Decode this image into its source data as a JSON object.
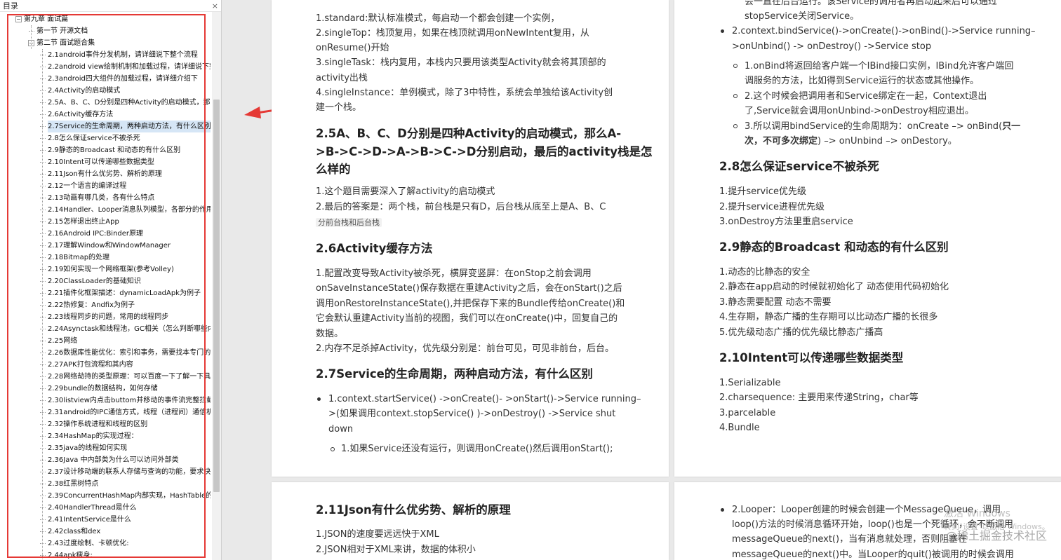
{
  "toc": {
    "title": "目录",
    "close": "×",
    "items": [
      {
        "label": "第九章 面试篇",
        "level": 0,
        "toggle": "−"
      },
      {
        "label": "第一节 开源文档",
        "level": 1
      },
      {
        "label": "第二节 面试题合集",
        "level": 1,
        "toggle": "−"
      },
      {
        "label": "2.1android事件分发机制，请详细说下整个流程",
        "level": 2
      },
      {
        "label": "2.2android view绘制机制和加载过程，请详细说下整",
        "level": 2
      },
      {
        "label": "2.3android四大组件的加载过程，请详细介绍下",
        "level": 2
      },
      {
        "label": "2.4Activity的启动模式",
        "level": 2
      },
      {
        "label": "2.5A、B、C、D分别是四种Activity的启动模式，那么A",
        "level": 2
      },
      {
        "label": "2.6Activity缓存方法",
        "level": 2
      },
      {
        "label": "2.7Service的生命周期，两种启动方法，有什么区别",
        "level": 2,
        "selected": true
      },
      {
        "label": "2.8怎么保证service不被杀死",
        "level": 2
      },
      {
        "label": "2.9静态的Broadcast 和动态的有什么区别",
        "level": 2
      },
      {
        "label": "2.10Intent可以传递哪些数据类型",
        "level": 2
      },
      {
        "label": "2.11Json有什么优劣势、解析的原理",
        "level": 2
      },
      {
        "label": "2.12一个语言的编译过程",
        "level": 2
      },
      {
        "label": "2.13动画有哪几类，各有什么特点",
        "level": 2
      },
      {
        "label": "2.14Handler、Looper消息队列模型，各部分的作用",
        "level": 2
      },
      {
        "label": "2.15怎样退出终止App",
        "level": 2
      },
      {
        "label": "2.16Android IPC:Binder原理",
        "level": 2
      },
      {
        "label": "2.17理解Window和WindowManager",
        "level": 2
      },
      {
        "label": "2.18Bitmap的处理",
        "level": 2
      },
      {
        "label": "2.19如何实现一个网络框架(参考Volley)",
        "level": 2
      },
      {
        "label": "2.20ClassLoader的基础知识",
        "level": 2
      },
      {
        "label": "2.21插件化框架描述：dynamicLoadApk为例子",
        "level": 2
      },
      {
        "label": "2.22热修复：Andfix为例子",
        "level": 2
      },
      {
        "label": "2.23线程同步的问题，常用的线程同步",
        "level": 2
      },
      {
        "label": "2.24Asynctask和线程池，GC相关（怎么判断哪些内",
        "level": 2
      },
      {
        "label": "2.25网络",
        "level": 2
      },
      {
        "label": "2.26数据库性能优化：索引和事务，需要找本专门的",
        "level": 2
      },
      {
        "label": "2.27APK打包流程和其内容",
        "level": 2
      },
      {
        "label": "2.28网络劫持的类型原理：可以百度一下了解一下具",
        "level": 2
      },
      {
        "label": "2.29bundle的数据结构，如何存储",
        "level": 2
      },
      {
        "label": "2.30listview内点击buttom并移动的事件流完整拦截",
        "level": 2
      },
      {
        "label": "2.31android的IPC通信方式，线程（进程间）通信机",
        "level": 2
      },
      {
        "label": "2.32操作系统进程和线程的区别",
        "level": 2
      },
      {
        "label": "2.34HashMap的实现过程：",
        "level": 2
      },
      {
        "label": "2.35java的线程如何实现",
        "level": 2
      },
      {
        "label": "2.36Java 中内部类为什么可以访问外部类",
        "level": 2
      },
      {
        "label": "2.37设计移动端的联系人存储与查询的功能，要求快",
        "level": 2
      },
      {
        "label": "2.38红黑树特点",
        "level": 2
      },
      {
        "label": "2.39ConcurrentHashMap内部实现，HashTable的",
        "level": 2
      },
      {
        "label": "2.40HandlerThread是什么",
        "level": 2
      },
      {
        "label": "2.41IntentService是什么",
        "level": 2
      },
      {
        "label": "2.42class和dex",
        "level": 2
      },
      {
        "label": "2.43过度绘制、卡顿优化:",
        "level": 2
      },
      {
        "label": "2.44apk瘦身:",
        "level": 2
      }
    ]
  },
  "page1": {
    "lines": [
      "1.standard:默认标准模式，每启动一个都会创建一个实例，",
      "2.singleTop：栈顶复用，如果在栈顶就调用onNewIntent复用，从",
      "onResume()开始",
      "3.singleTask：栈内复用，本栈内只要用该类型Activity就会将其顶部的",
      "activity出栈",
      "4.singleInstance：单例模式，除了3中特性，系统会单独给该Activity创",
      "建一个栈。"
    ],
    "h25": [
      "2.5A、B、C、D分别是四种Activity的启动模式，那么A-",
      ">B->C->D->A->B->C->D分别启动，最后的activity栈是怎",
      "么样的"
    ],
    "s25": [
      "1.这个题目需要深入了解activity的启动模式",
      "2.最后的答案是：两个栈，前台栈是只有D，后台栈从底至上是A、B、C"
    ],
    "s25_code": "分前台栈和后台栈",
    "h26": "2.6Activity缓存方法",
    "s26": [
      "1.配置改变导致Activity被杀死，横屏变竖屏：在onStop之前会调用",
      "onSaveInstanceState()保存数据在重建Activity之后，会在onStart()之后",
      "调用onRestoreInstanceState(),并把保存下来的Bundle传给onCreate()和",
      "它会默认重建Activity当前的视图，我们可以在onCreate()中，回复自己的",
      "数据。",
      "2.内存不足杀掉Activity，优先级分别是：前台可见，可见非前台，后台。"
    ],
    "h27": "2.7Service的生命周期，两种启动方法，有什么区别",
    "s27": [
      "1.context.startService() ->onCreate()- >onStart()->Service running–",
      ">(如果调用context.stopService() )->onDestroy() ->Service shut",
      "down"
    ],
    "s27_sub": "1.如果Service还没有运行，则调用onCreate()然后调用onStart();"
  },
  "page2": {
    "top": [
      "会一直在后台运行。该Service的调用者再启动起来后可以通过",
      "stopService关闭Service。"
    ],
    "bind": [
      "2.context.bindService()->onCreate()->onBind()->Service running–",
      ">onUnbind() -> onDestroy() ->Service stop"
    ],
    "bind_sub": [
      "1.onBind将返回给客户端一个IBind接口实例，IBind允许客户端回",
      "调服务的方法，比如得到Service运行的状态或其他操作。",
      "2.这个时候会把调用者和Service绑定在一起，Context退出",
      "了,Service就会调用onUnbind->onDestroy相应退出。",
      "3.所以调用bindService的生命周期为：onCreate –> onBind(",
      "只一",
      "次，不可多次绑定",
      ") –> onUnbind –> onDestory。"
    ],
    "h28": "2.8怎么保证service不被杀死",
    "s28": [
      "1.提升service优先级",
      "2.提升service进程优先级",
      "3.onDestroy方法里重启service"
    ],
    "h29": "2.9静态的Broadcast 和动态的有什么区别",
    "s29": [
      "1.动态的比静态的安全",
      "2.静态在app启动的时候就初始化了 动态使用代码初始化",
      "3.静态需要配置 动态不需要",
      "4.生存期，静态广播的生存期可以比动态广播的长很多",
      "5.优先级动态广播的优先级比静态广播高"
    ],
    "h210": "2.10Intent可以传递哪些数据类型",
    "s210": [
      "1.Serializable",
      "2.charsequence: 主要用来传递String，char等",
      "3.parcelable",
      "4.Bundle"
    ]
  },
  "page3": {
    "h211": "2.11Json有什么优劣势、解析的原理",
    "s211": [
      "1.JSON的速度要远远快于XML",
      "2.JSON相对于XML来讲，数据的体积小"
    ]
  },
  "page4": {
    "lines": [
      "2.Looper：Looper创建的时候会创建一个MessageQueue，调用",
      "loop()方法的时候消息循环开始，loop()也是一个死循环，会不断调用",
      "messageQueue的next()，当有消息就处理，否则阻塞在",
      "messageQueue的next()中。当Looper的quit()被调用的时候会调用"
    ]
  },
  "overlay": {
    "watermark": "@稀土掘金技术社区",
    "activate1": "激活 Windows",
    "activate2": "转到\"设置\"以激活 Windows。"
  },
  "colors": {
    "highlight": "#e53935",
    "selected_row": "#d6e6f6"
  }
}
